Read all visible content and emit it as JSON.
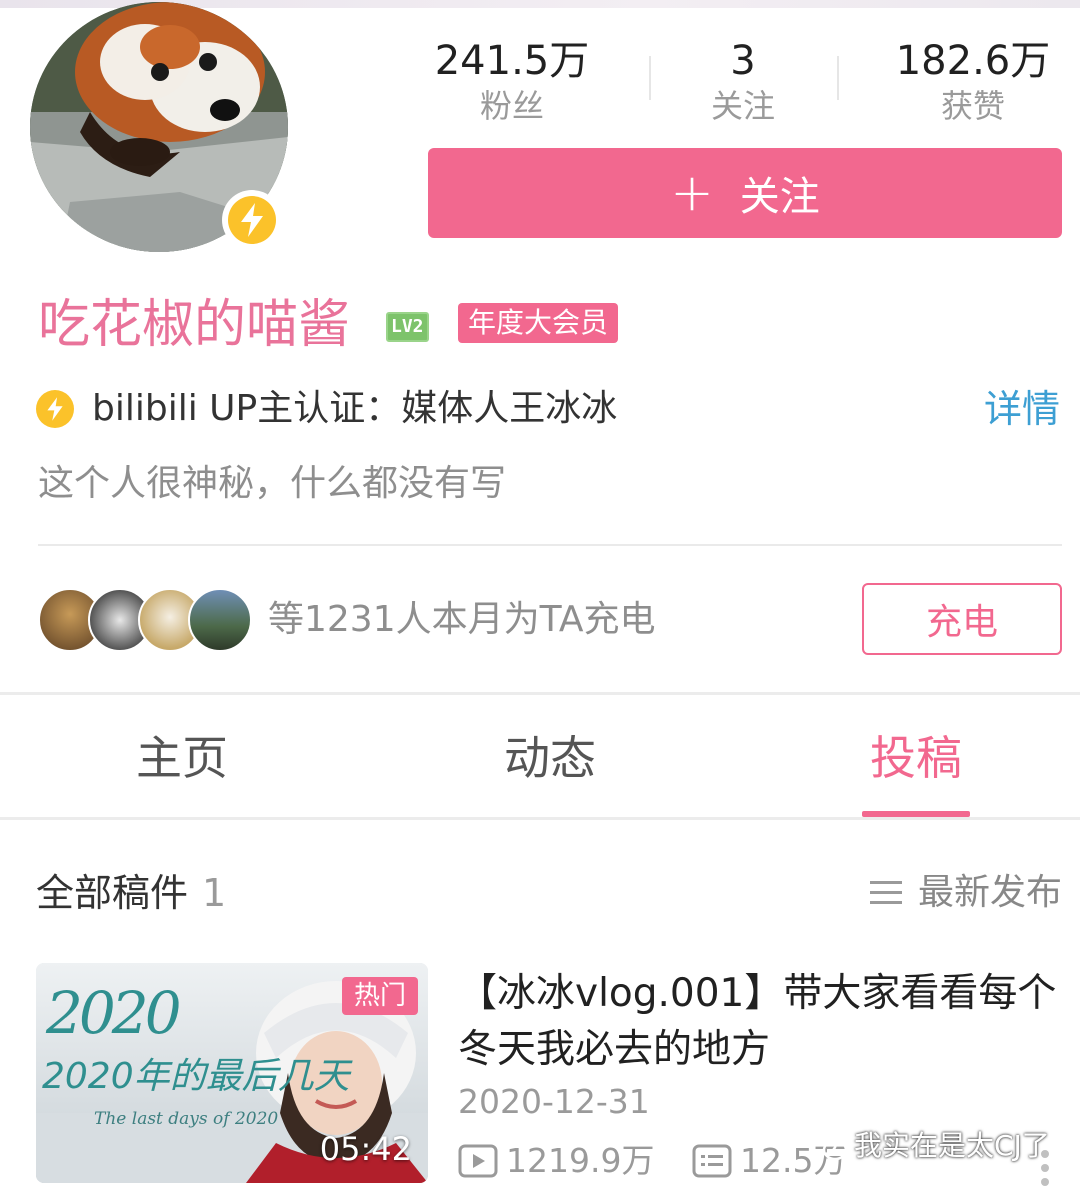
{
  "stats": [
    {
      "value": "241.5万",
      "label": "粉丝"
    },
    {
      "value": "3",
      "label": "关注"
    },
    {
      "value": "182.6万",
      "label": "获赞"
    }
  ],
  "follow_button": {
    "plus": "+",
    "label": "关注"
  },
  "user": {
    "name": "吃花椒的喵酱",
    "level": "LV2",
    "vip": "年度大会员",
    "certification": "bilibili UP主认证：媒体人王冰冰",
    "details_link": "详情",
    "bio": "这个人很神秘，什么都没有写"
  },
  "charge": {
    "text": "等1231人本月为TA充电",
    "button": "充电"
  },
  "tabs": [
    {
      "label": "主页",
      "active": false
    },
    {
      "label": "动态",
      "active": false
    },
    {
      "label": "投稿",
      "active": true
    }
  ],
  "posts": {
    "title": "全部稿件",
    "count": "1",
    "sort_label": "最新发布"
  },
  "video": {
    "hot_badge": "热门",
    "duration": "05:42",
    "title": "【冰冰vlog.001】带大家看看每个冬天我必去的地方",
    "date": "2020-12-31",
    "plays": "1219.9万",
    "danmaku": "12.5万",
    "thumb_text": "2020年的最后几天",
    "thumb_subtext": "The last days of 2020"
  },
  "watermark": "我实在是太CJ了",
  "colors": {
    "accent_pink": "#f2688f",
    "name_pink": "#e9739a",
    "link_blue": "#3d9fd3",
    "badge_yellow": "#fbc22a",
    "level_green": "#7dc36b"
  }
}
